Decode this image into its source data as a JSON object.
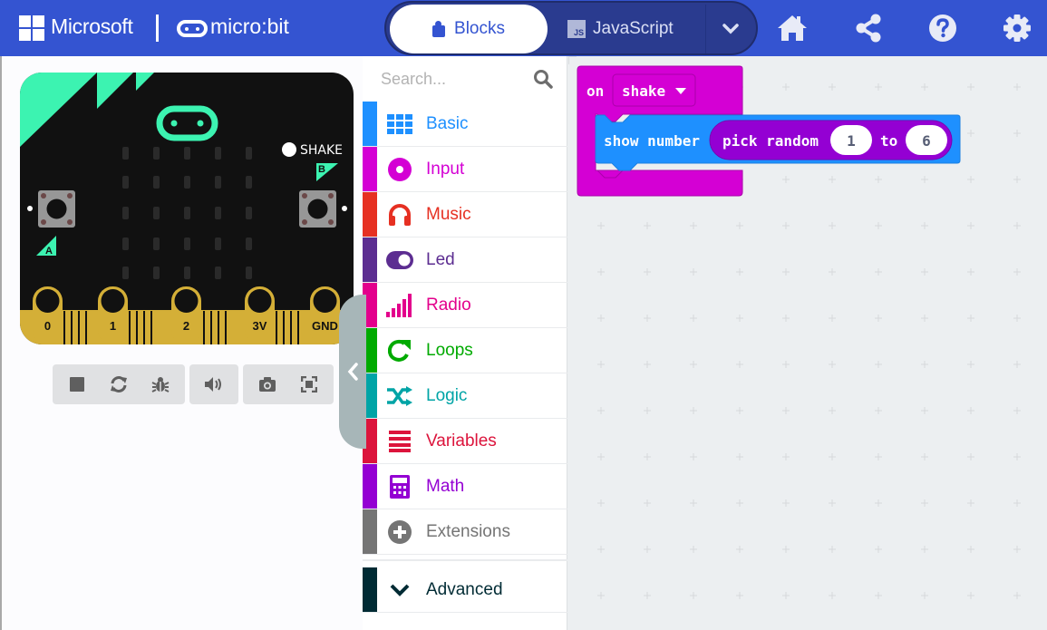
{
  "header": {
    "brand": "Microsoft",
    "product": "micro:bit",
    "tabs": [
      {
        "label": "Blocks",
        "icon": "puzzle-icon",
        "active": true
      },
      {
        "label": "JavaScript",
        "icon": "js-icon",
        "badge": "JS",
        "active": false
      }
    ],
    "icons": [
      "home-icon",
      "share-icon",
      "help-icon",
      "settings-icon"
    ],
    "color": "#3454d1"
  },
  "simulator": {
    "shake_label": "SHAKE",
    "button_a": "A",
    "button_b": "B",
    "pins": [
      "0",
      "1",
      "2",
      "3V",
      "GND"
    ],
    "toolbar": [
      "stop-icon",
      "restart-icon",
      "debug-icon",
      "sound-icon",
      "screenshot-icon",
      "fullscreen-icon"
    ]
  },
  "toolbox": {
    "search_placeholder": "Search...",
    "categories": [
      {
        "label": "Basic",
        "color": "#1e90ff",
        "icon": "grid-icon"
      },
      {
        "label": "Input",
        "color": "#d400d4",
        "icon": "input-target-icon"
      },
      {
        "label": "Music",
        "color": "#e63022",
        "icon": "headphones-icon"
      },
      {
        "label": "Led",
        "color": "#5c2d91",
        "icon": "toggle-icon"
      },
      {
        "label": "Radio",
        "color": "#e3008c",
        "icon": "signal-bars-icon"
      },
      {
        "label": "Loops",
        "color": "#00aa00",
        "icon": "loop-arrow-icon"
      },
      {
        "label": "Logic",
        "color": "#00a4a6",
        "icon": "shuffle-icon"
      },
      {
        "label": "Variables",
        "color": "#dc143c",
        "icon": "lines-icon"
      },
      {
        "label": "Math",
        "color": "#9400d3",
        "icon": "calculator-icon"
      },
      {
        "label": "Extensions",
        "color": "#757575",
        "icon": "plus-circle-icon"
      }
    ],
    "advanced": {
      "label": "Advanced",
      "color": "#002b34"
    }
  },
  "workspace": {
    "event_block": {
      "keyword": "on",
      "dropdown_value": "shake",
      "color": "#d400d4"
    },
    "statement_block": {
      "label": "show number",
      "color": "#1e90ff"
    },
    "reporter_block": {
      "label": "pick random",
      "from": "1",
      "to_label": "to",
      "to": "6",
      "color": "#9400d3"
    }
  }
}
